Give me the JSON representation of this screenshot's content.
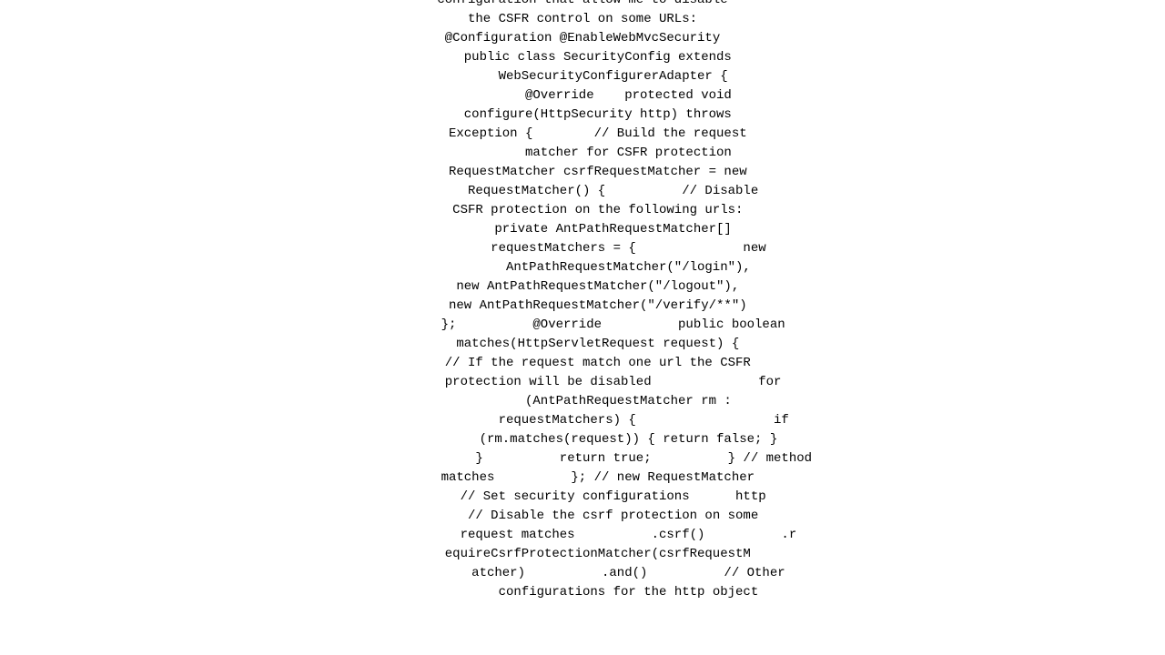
{
  "code": {
    "lines": [
      "configuration that allow me to disable",
      "the CSFR control on some URLs:",
      "@Configuration @EnableWebMvcSecurity",
      "    public class SecurityConfig extends",
      "        WebSecurityConfigurerAdapter {",
      "            @Override    protected void",
      "    configure(HttpSecurity http) throws",
      "    Exception {        // Build the request",
      "            matcher for CSFR protection",
      "    RequestMatcher csrfRequestMatcher = new",
      "        RequestMatcher() {          // Disable",
      "    CSFR protection on the following urls:",
      "        private AntPathRequestMatcher[]",
      "            requestMatchers = {              new",
      "            AntPathRequestMatcher(\"/login\"),",
      "    new AntPathRequestMatcher(\"/logout\"),",
      "    new AntPathRequestMatcher(\"/verify/**\")",
      "        };          @Override          public boolean",
      "    matches(HttpServletRequest request) {",
      "    // If the request match one url the CSFR",
      "        protection will be disabled              for",
      "            (AntPathRequestMatcher rm :",
      "                requestMatchers) {                  if",
      "            (rm.matches(request)) { return false; }",
      "                }          return true;          } // method",
      "    matches          }; // new RequestMatcher",
      "        // Set security configurations      http",
      "        // Disable the csrf protection on some",
      "            request matches          .csrf()          .r",
      "    equireCsrfProtectionMatcher(csrfRequestM",
      "            atcher)          .and()          // Other",
      "            configurations for the http object"
    ]
  }
}
